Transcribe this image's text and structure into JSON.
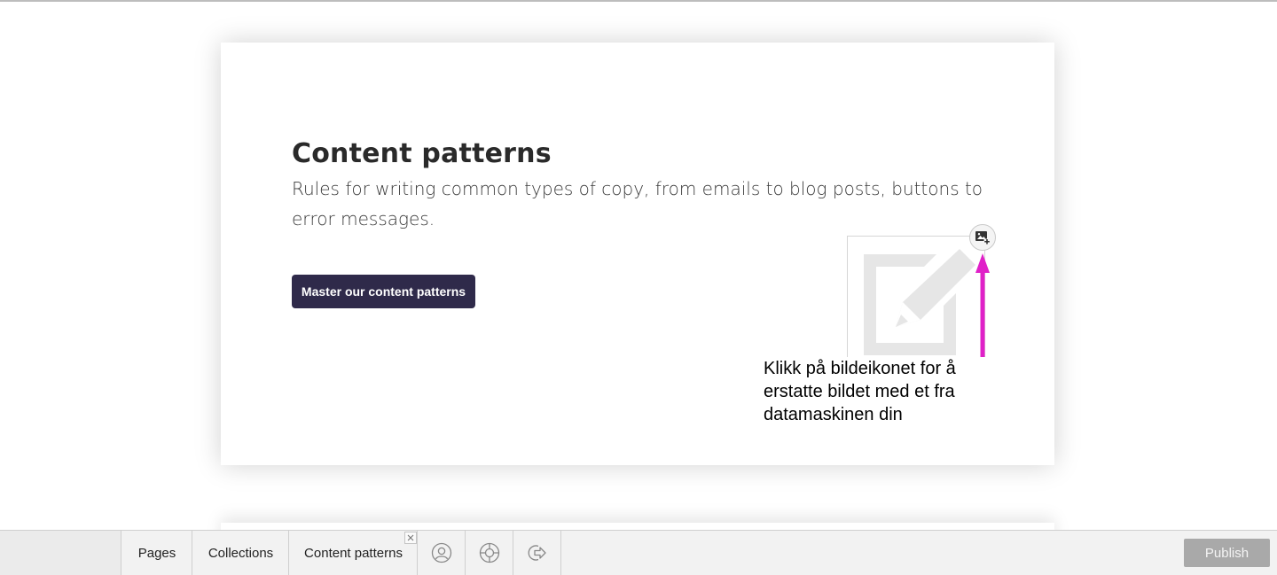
{
  "section": {
    "title": "Content patterns",
    "subtitle": "Rules for writing common types of copy, from emails to blog posts, buttons to error messages.",
    "cta_label": "Master our content patterns"
  },
  "image": {
    "placeholder_icon": "edit-pencil-icon",
    "replace_icon": "image-add-icon"
  },
  "annotation": {
    "text": "Klikk på bildeikonet for å erstatte bildet med et fra datamaskinen din",
    "arrow_color": "#e020c8"
  },
  "toolbar": {
    "tabs": [
      {
        "label": "Pages"
      },
      {
        "label": "Collections"
      },
      {
        "label": "Content patterns"
      }
    ],
    "icons": [
      "user-circle-icon",
      "help-lifebuoy-icon",
      "logout-icon"
    ],
    "publish_label": "Publish"
  },
  "colors": {
    "cta_bg": "#2f2a4a",
    "publish_bg": "#a9a9a9",
    "arrow": "#e020c8"
  }
}
